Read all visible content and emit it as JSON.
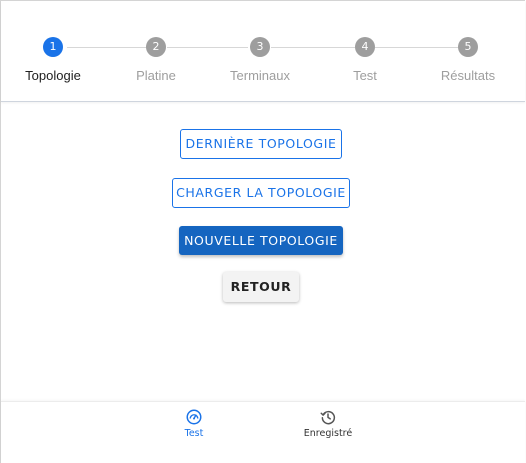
{
  "stepper": {
    "steps": [
      {
        "number": "1",
        "label": "Topologie",
        "state": "active"
      },
      {
        "number": "2",
        "label": "Platine",
        "state": "inactive"
      },
      {
        "number": "3",
        "label": "Terminaux",
        "state": "inactive"
      },
      {
        "number": "4",
        "label": "Test",
        "state": "inactive"
      },
      {
        "number": "5",
        "label": "Résultats",
        "state": "inactive"
      }
    ]
  },
  "actions": {
    "last_topology": "DERNIÈRE TOPOLOGIE",
    "load_topology": "CHARGER LA TOPOLOGIE",
    "new_topology": "NOUVELLE TOPOLOGIE",
    "back": "RETOUR"
  },
  "bottom_nav": {
    "items": [
      {
        "label": "Test",
        "icon": "speedometer-icon",
        "active": true
      },
      {
        "label": "Enregistré",
        "icon": "history-icon",
        "active": false
      }
    ]
  },
  "colors": {
    "accent": "#1a73e8",
    "primary_button": "#1565c0",
    "inactive_step": "#9e9e9e",
    "active_label": "#212121",
    "inactive_label": "#9e9e9e"
  }
}
